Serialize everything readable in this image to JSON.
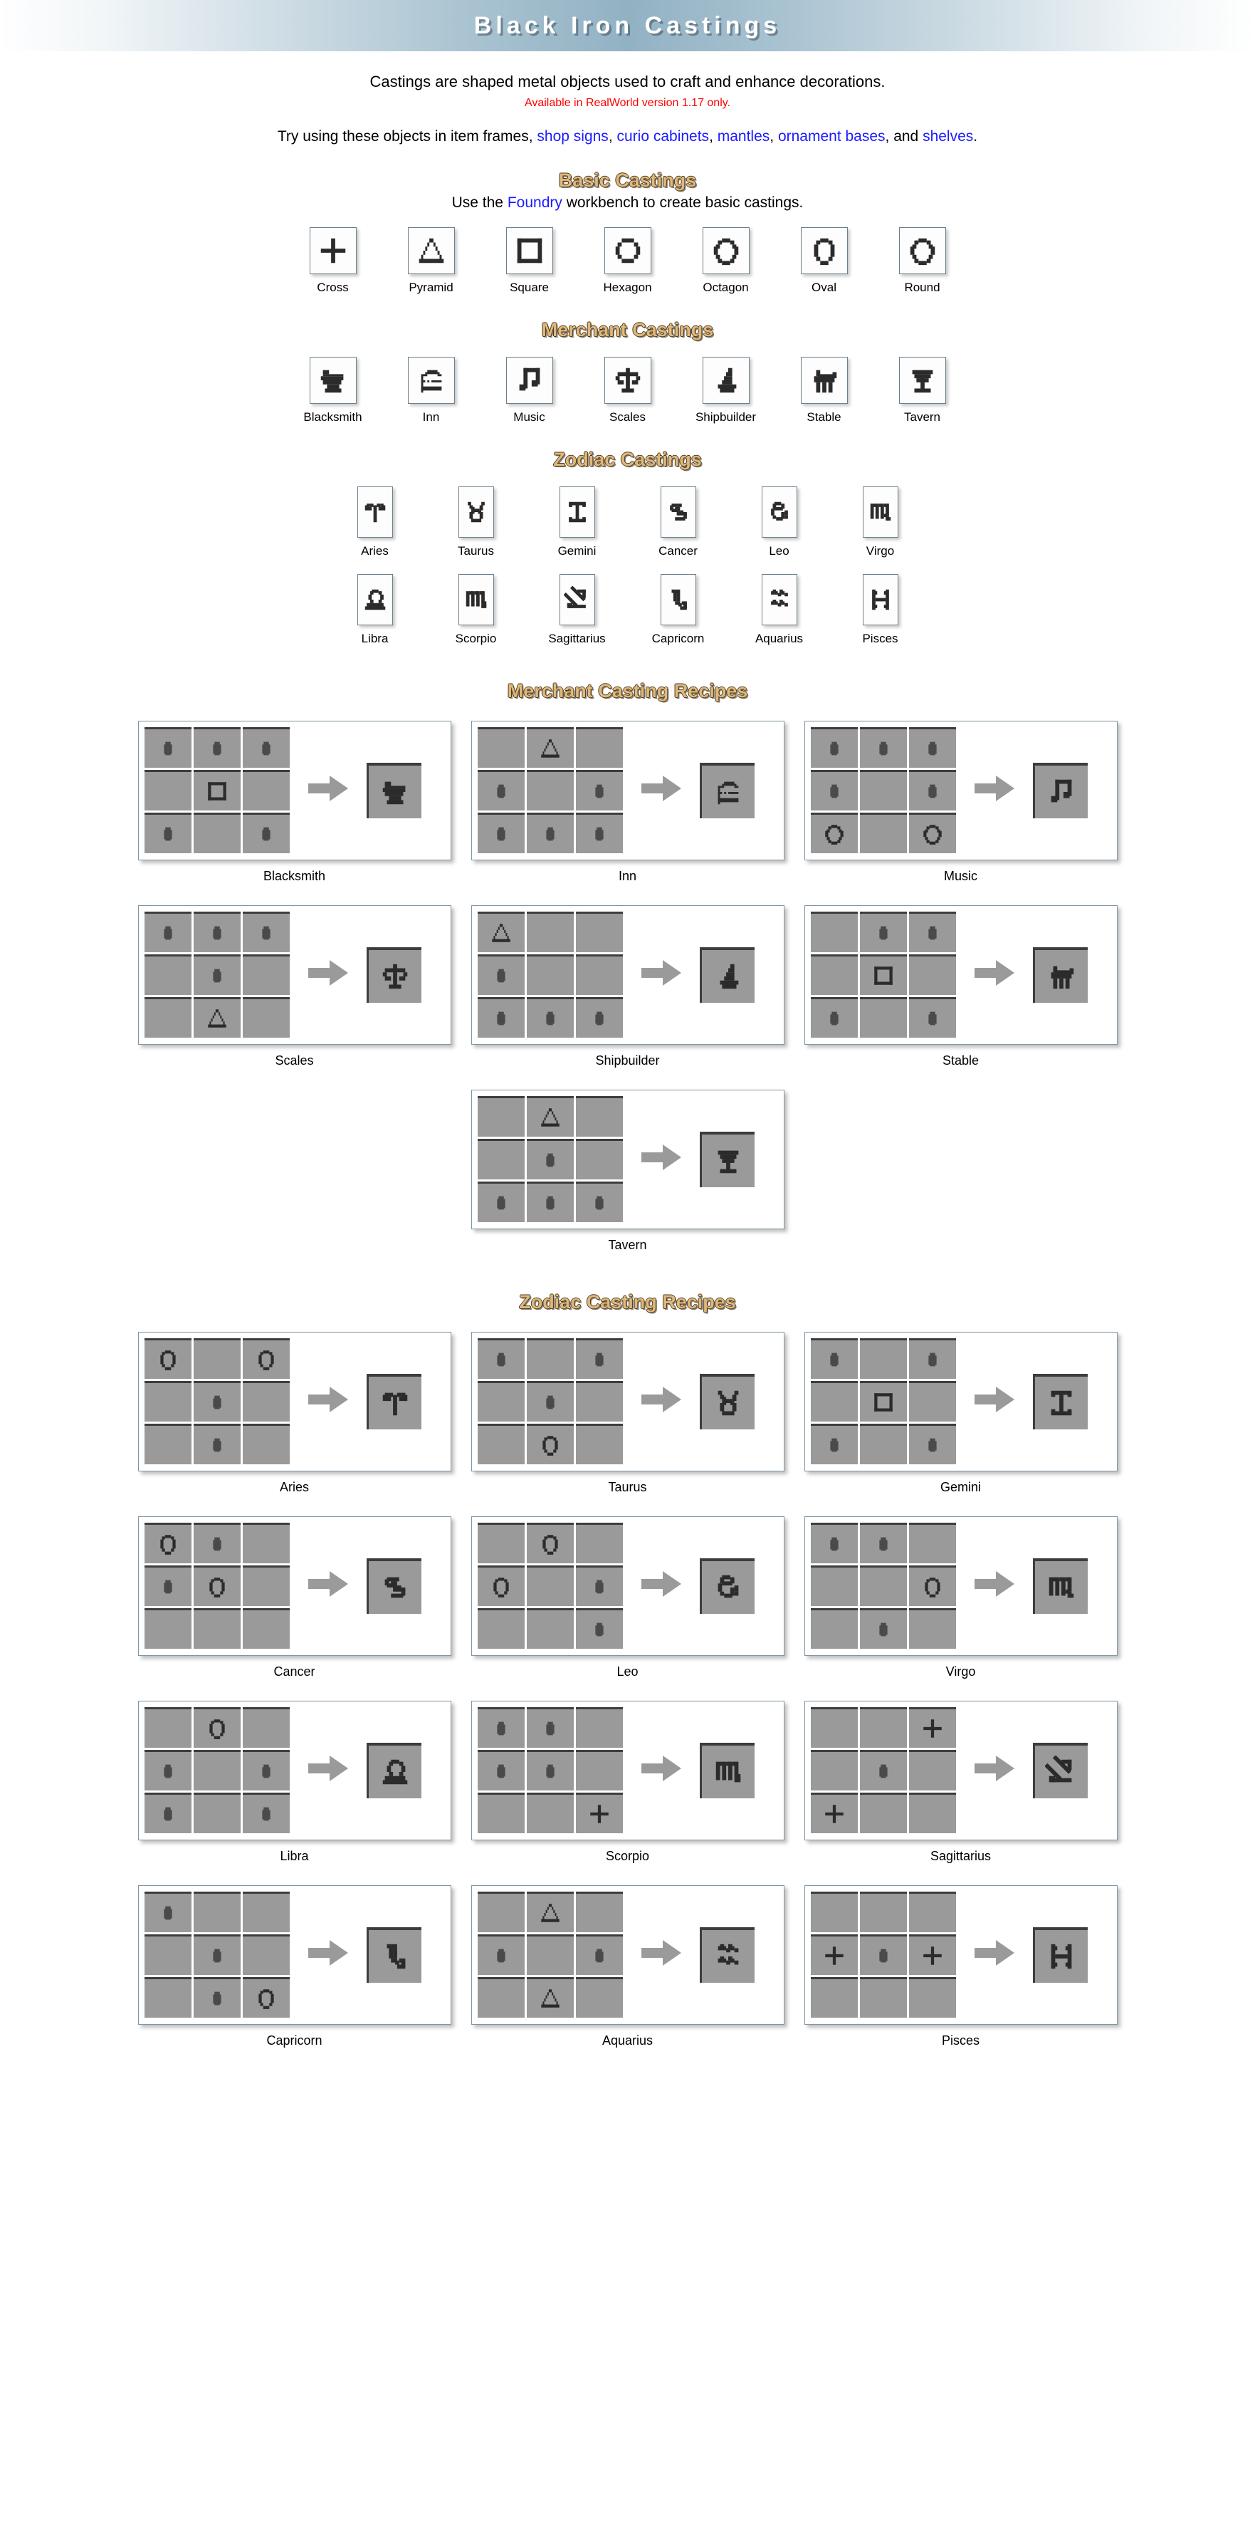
{
  "header": {
    "title": "Black Iron Castings"
  },
  "intro": {
    "line1": "Castings are shaped metal objects used to craft and enhance decorations.",
    "note": "Available in RealWorld version 1.17 only.",
    "links_prefix": "Try using these objects in item frames, ",
    "link1": "shop signs",
    "sep1": ", ",
    "link2": "curio cabinets",
    "sep2": ", ",
    "link3": "mantles",
    "sep3": ", ",
    "link4": "ornament bases",
    "sep4": ", and ",
    "link5": "shelves",
    "suffix": "."
  },
  "basic": {
    "heading": "Basic Castings",
    "sub_prefix": "Use the ",
    "sub_link": "Foundry",
    "sub_suffix": " workbench to create basic castings.",
    "items": [
      {
        "label": "Cross",
        "icon": "cross-casting-icon"
      },
      {
        "label": "Pyramid",
        "icon": "pyramid-casting-icon"
      },
      {
        "label": "Square",
        "icon": "square-casting-icon"
      },
      {
        "label": "Hexagon",
        "icon": "hexagon-casting-icon"
      },
      {
        "label": "Octagon",
        "icon": "octagon-casting-icon"
      },
      {
        "label": "Oval",
        "icon": "oval-casting-icon"
      },
      {
        "label": "Round",
        "icon": "round-casting-icon"
      }
    ]
  },
  "merchant": {
    "heading": "Merchant Castings",
    "items": [
      {
        "label": "Blacksmith",
        "icon": "anvil-icon"
      },
      {
        "label": "Inn",
        "icon": "bed-icon"
      },
      {
        "label": "Music",
        "icon": "music-note-icon"
      },
      {
        "label": "Scales",
        "icon": "scales-icon"
      },
      {
        "label": "Shipbuilder",
        "icon": "sailboat-icon"
      },
      {
        "label": "Stable",
        "icon": "horse-icon"
      },
      {
        "label": "Tavern",
        "icon": "cocktail-glass-icon"
      }
    ]
  },
  "zodiac": {
    "heading": "Zodiac Castings",
    "row1": [
      {
        "label": "Aries",
        "icon": "aries-icon"
      },
      {
        "label": "Taurus",
        "icon": "taurus-icon"
      },
      {
        "label": "Gemini",
        "icon": "gemini-icon"
      },
      {
        "label": "Cancer",
        "icon": "cancer-icon"
      },
      {
        "label": "Leo",
        "icon": "leo-icon"
      },
      {
        "label": "Virgo",
        "icon": "virgo-icon"
      }
    ],
    "row2": [
      {
        "label": "Libra",
        "icon": "libra-icon"
      },
      {
        "label": "Scorpio",
        "icon": "scorpio-icon"
      },
      {
        "label": "Sagittarius",
        "icon": "sagittarius-icon"
      },
      {
        "label": "Capricorn",
        "icon": "capricorn-icon"
      },
      {
        "label": "Aquarius",
        "icon": "aquarius-icon"
      },
      {
        "label": "Pisces",
        "icon": "pisces-icon"
      }
    ]
  },
  "merchant_recipes": {
    "heading": "Merchant Casting Recipes",
    "recipes": [
      {
        "label": "Blacksmith",
        "result": "anvil-icon",
        "grid": [
          "ingot",
          "ingot",
          "ingot",
          "",
          "square",
          "",
          "ingot",
          "",
          "ingot"
        ]
      },
      {
        "label": "Inn",
        "result": "bed-icon",
        "grid": [
          "",
          "pyramid",
          "",
          "ingot",
          "",
          "ingot",
          "ingot",
          "ingot",
          "ingot"
        ]
      },
      {
        "label": "Music",
        "result": "music-note-icon",
        "grid": [
          "ingot",
          "ingot",
          "ingot",
          "ingot",
          "",
          "ingot",
          "octagon",
          "",
          "octagon"
        ]
      },
      {
        "label": "Scales",
        "result": "scales-icon",
        "grid": [
          "ingot",
          "ingot",
          "ingot",
          "",
          "ingot",
          "",
          "",
          "pyramid",
          ""
        ]
      },
      {
        "label": "Shipbuilder",
        "result": "sailboat-icon",
        "grid": [
          "pyramid",
          "",
          "",
          "ingot",
          "",
          "",
          "ingot",
          "ingot",
          "ingot"
        ]
      },
      {
        "label": "Stable",
        "result": "horse-icon",
        "grid": [
          "",
          "ingot",
          "ingot",
          "",
          "square",
          "",
          "ingot",
          "",
          "ingot"
        ]
      },
      {
        "label": "Tavern",
        "result": "cocktail-glass-icon",
        "grid": [
          "",
          "pyramid",
          "",
          "",
          "ingot",
          "",
          "ingot",
          "ingot",
          "ingot"
        ]
      }
    ]
  },
  "zodiac_recipes": {
    "heading": "Zodiac Casting Recipes",
    "recipes": [
      {
        "label": "Aries",
        "result": "aries-icon",
        "grid": [
          "oval",
          "",
          "oval",
          "",
          "ingot",
          "",
          "",
          "ingot",
          ""
        ]
      },
      {
        "label": "Taurus",
        "result": "taurus-icon",
        "grid": [
          "ingot",
          "",
          "ingot",
          "",
          "ingot",
          "",
          "",
          "oval",
          ""
        ]
      },
      {
        "label": "Gemini",
        "result": "gemini-icon",
        "grid": [
          "ingot",
          "",
          "ingot",
          "",
          "square",
          "",
          "ingot",
          "",
          "ingot"
        ]
      },
      {
        "label": "Cancer",
        "result": "cancer-icon",
        "grid": [
          "oval",
          "ingot",
          "",
          "ingot",
          "oval",
          "",
          "",
          "",
          ""
        ]
      },
      {
        "label": "Leo",
        "result": "leo-icon",
        "grid": [
          "",
          "oval",
          "",
          "oval",
          "",
          "ingot",
          "",
          "",
          "ingot"
        ]
      },
      {
        "label": "Virgo",
        "result": "virgo-icon",
        "grid": [
          "ingot",
          "ingot",
          "",
          "",
          "",
          "oval",
          "",
          "ingot",
          ""
        ]
      },
      {
        "label": "Libra",
        "result": "libra-icon",
        "grid": [
          "",
          "oval",
          "",
          "ingot",
          "",
          "ingot",
          "ingot",
          "",
          "ingot"
        ]
      },
      {
        "label": "Scorpio",
        "result": "scorpio-icon",
        "grid": [
          "ingot",
          "ingot",
          "",
          "ingot",
          "ingot",
          "",
          "",
          "",
          "cross"
        ]
      },
      {
        "label": "Sagittarius",
        "result": "sagittarius-icon",
        "grid": [
          "",
          "",
          "cross",
          "",
          "ingot",
          "",
          "cross",
          "",
          ""
        ]
      },
      {
        "label": "Capricorn",
        "result": "capricorn-icon",
        "grid": [
          "ingot",
          "",
          "",
          "",
          "ingot",
          "",
          "",
          "ingot",
          "oval"
        ]
      },
      {
        "label": "Aquarius",
        "result": "aquarius-icon",
        "grid": [
          "",
          "pyramid",
          "",
          "ingot",
          "",
          "ingot",
          "",
          "pyramid",
          ""
        ]
      },
      {
        "label": "Pisces",
        "result": "pisces-icon",
        "grid": [
          "",
          "",
          "",
          "cross",
          "ingot",
          "cross",
          "",
          "",
          ""
        ]
      }
    ]
  },
  "colors": {
    "banner_accent": "#92b2c4",
    "heading_gold": "#e0b87a",
    "link_blue": "#1b1bff",
    "note_red": "#ff0000",
    "cell_gray": "#9a9a9a"
  }
}
